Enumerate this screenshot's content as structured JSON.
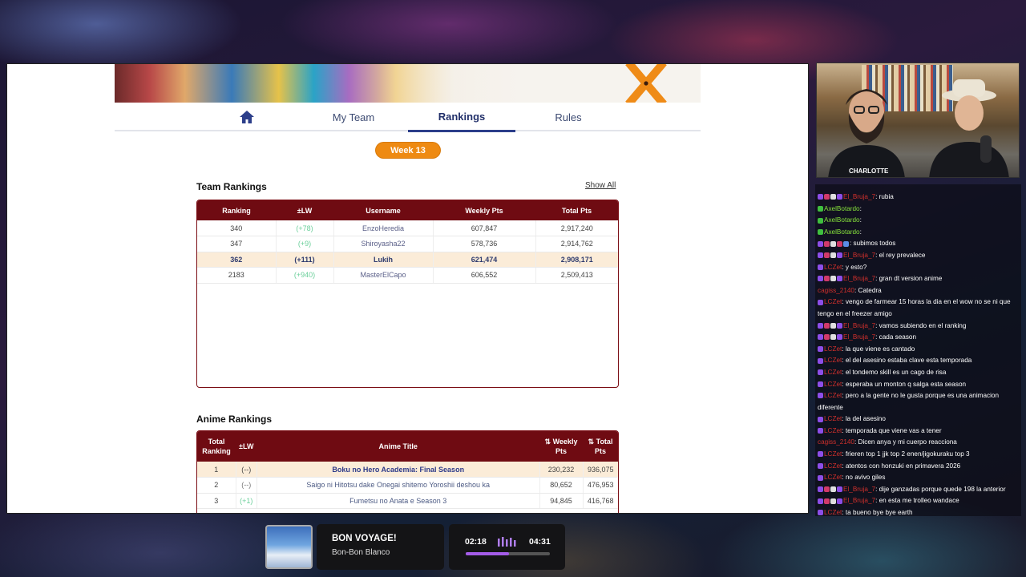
{
  "nav": {
    "home_icon": "home-icon",
    "my_team": "My Team",
    "rankings": "Rankings",
    "rules": "Rules"
  },
  "week_badge": "Week 13",
  "team_rankings": {
    "title": "Team Rankings",
    "show_all": "Show All",
    "headers": [
      "Ranking",
      "±LW",
      "Username",
      "Weekly Pts",
      "Total Pts"
    ],
    "rows": [
      {
        "ranking": "340",
        "lw": "(+78)",
        "username": "EnzoHeredia",
        "weekly": "607,847",
        "total": "2,917,240",
        "highlight": false
      },
      {
        "ranking": "347",
        "lw": "(+9)",
        "username": "Shiroyasha22",
        "weekly": "578,736",
        "total": "2,914,762",
        "highlight": false
      },
      {
        "ranking": "362",
        "lw": "(+111)",
        "username": "Lukih",
        "weekly": "621,474",
        "total": "2,908,171",
        "highlight": true
      },
      {
        "ranking": "2183",
        "lw": "(+940)",
        "username": "MasterElCapo",
        "weekly": "606,552",
        "total": "2,509,413",
        "highlight": false
      }
    ]
  },
  "anime_rankings": {
    "title": "Anime Rankings",
    "headers": {
      "total_ranking": "Total Ranking",
      "lw": "±LW",
      "anime_title": "Anime Title",
      "weekly_pts": "Weekly Pts",
      "total_pts": "Total Pts"
    },
    "rows": [
      {
        "rank": "1",
        "lw": "(--)",
        "title": "Boku no Hero Academia: Final Season",
        "weekly": "230,232",
        "total": "936,075",
        "highlight": true
      },
      {
        "rank": "2",
        "lw": "(--)",
        "title": "Saigo ni Hitotsu dake Onegai shitemo Yoroshii deshou ka",
        "weekly": "80,652",
        "total": "476,953",
        "highlight": false
      },
      {
        "rank": "3",
        "lw": "(+1)",
        "title": "Fumetsu no Anata e Season 3",
        "weekly": "94,845",
        "total": "416,768",
        "highlight": false
      }
    ]
  },
  "webcam": {
    "label": "CHARLOTTE"
  },
  "chat": [
    {
      "user": "El_Bruja_7",
      "color": "#d0302c",
      "badges": [
        "#8d4ee8",
        "#d03a6a",
        "#e0e0e0",
        "#8d4ee8"
      ],
      "text": ": rubia"
    },
    {
      "user": "AxelBotardo",
      "color": "#86e13b",
      "badges": [
        "#3fbf3f"
      ],
      "text": ": "
    },
    {
      "user": "AxelBotardo",
      "color": "#86e13b",
      "badges": [
        "#3fbf3f"
      ],
      "text": ": "
    },
    {
      "user": "AxelBotardo",
      "color": "#86e13b",
      "badges": [
        "#3fbf3f"
      ],
      "text": ": "
    },
    {
      "user": "",
      "color": "#8d4ee8",
      "badges": [
        "#8d4ee8",
        "#d03a6a",
        "#e0e0e0",
        "#d03a6a",
        "#5b8ee8"
      ],
      "text": ": subimos todos"
    },
    {
      "user": "El_Bruja_7",
      "color": "#d0302c",
      "badges": [
        "#8d4ee8",
        "#d03a6a",
        "#e0e0e0",
        "#8d4ee8"
      ],
      "text": ": el rey prevalece"
    },
    {
      "user": "LCZet",
      "color": "#d0302c",
      "badges": [
        "#8d4ee8"
      ],
      "text": ": y esto?"
    },
    {
      "user": "El_Bruja_7",
      "color": "#d0302c",
      "badges": [
        "#8d4ee8",
        "#d03a6a",
        "#e0e0e0",
        "#8d4ee8"
      ],
      "text": ": gran dt version anime"
    },
    {
      "user": "cagiss_2140",
      "color": "#d0302c",
      "badges": [],
      "text": ": Catedra"
    },
    {
      "user": "LCZet",
      "color": "#d0302c",
      "badges": [
        "#8d4ee8"
      ],
      "text": ": vengo de farmear 15 horas la dia en el wow no se ni que tengo en el freezer amigo"
    },
    {
      "user": "El_Bruja_7",
      "color": "#d0302c",
      "badges": [
        "#8d4ee8",
        "#d03a6a",
        "#e0e0e0",
        "#8d4ee8"
      ],
      "text": ": vamos subiendo en el ranking"
    },
    {
      "user": "El_Bruja_7",
      "color": "#d0302c",
      "badges": [
        "#8d4ee8",
        "#d03a6a",
        "#e0e0e0",
        "#8d4ee8"
      ],
      "text": ": cada season"
    },
    {
      "user": "LCZet",
      "color": "#d0302c",
      "badges": [
        "#8d4ee8"
      ],
      "text": ": la que viene es cantado"
    },
    {
      "user": "LCZet",
      "color": "#d0302c",
      "badges": [
        "#8d4ee8"
      ],
      "text": ": el del asesino estaba clave esta temporada"
    },
    {
      "user": "LCZet",
      "color": "#d0302c",
      "badges": [
        "#8d4ee8"
      ],
      "text": ": el tondemo skill es un cago de risa"
    },
    {
      "user": "LCZet",
      "color": "#d0302c",
      "badges": [
        "#8d4ee8"
      ],
      "text": ": esperaba un monton q salga esta season"
    },
    {
      "user": "LCZet",
      "color": "#d0302c",
      "badges": [
        "#8d4ee8"
      ],
      "text": ": pero a la gente no le gusta porque es una animacion diferente"
    },
    {
      "user": "LCZet",
      "color": "#d0302c",
      "badges": [
        "#8d4ee8"
      ],
      "text": ": la del asesino"
    },
    {
      "user": "LCZet",
      "color": "#d0302c",
      "badges": [
        "#8d4ee8"
      ],
      "text": ": temporada que viene vas a tener"
    },
    {
      "user": "cagiss_2140",
      "color": "#d0302c",
      "badges": [],
      "text": ": Dicen anya y mi cuerpo reacciona"
    },
    {
      "user": "LCZet",
      "color": "#d0302c",
      "badges": [
        "#8d4ee8"
      ],
      "text": ": frieren top 1 jjk top 2 enen/jigokuraku top 3"
    },
    {
      "user": "LCZet",
      "color": "#d0302c",
      "badges": [
        "#8d4ee8"
      ],
      "text": ": atentos con honzuki en primavera 2026"
    },
    {
      "user": "LCZet",
      "color": "#d0302c",
      "badges": [
        "#8d4ee8"
      ],
      "text": ": no avivo giles"
    },
    {
      "user": "El_Bruja_7",
      "color": "#d0302c",
      "badges": [
        "#8d4ee8",
        "#d03a6a",
        "#e0e0e0",
        "#8d4ee8"
      ],
      "text": ": dije ganzadas porque quede 198 la anterior"
    },
    {
      "user": "El_Bruja_7",
      "color": "#d0302c",
      "badges": [
        "#8d4ee8",
        "#d03a6a",
        "#e0e0e0",
        "#8d4ee8"
      ],
      "text": ": en esta me trolleo wandace"
    },
    {
      "user": "LCZet",
      "color": "#d0302c",
      "badges": [
        "#8d4ee8"
      ],
      "text": ": ta bueno bye bye earth"
    }
  ],
  "now_playing": {
    "title": "BON VOYAGE!",
    "artist": "Bon-Bon Blanco",
    "elapsed": "02:18",
    "duration": "04:31",
    "progress": 0.51
  }
}
